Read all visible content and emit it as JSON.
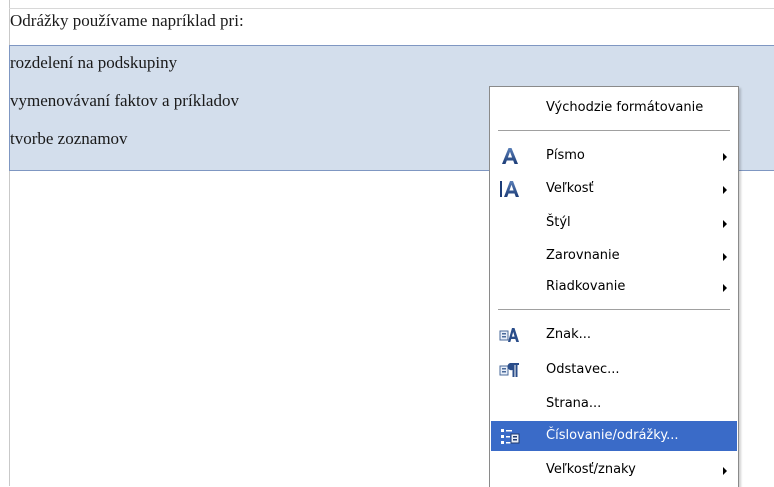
{
  "document": {
    "paragraphs": [
      "Odrážky používame napríklad pri:",
      "rozdelení na podskupiny",
      "vymenovávaní faktov a príkladov",
      "tvorbe zoznamov"
    ]
  },
  "context_menu": {
    "items": [
      {
        "label": "Východzie formátovanie",
        "icon": "",
        "submenu": false,
        "highlighted": false
      },
      {
        "label": "Písmo",
        "icon": "font-icon",
        "submenu": true,
        "highlighted": false
      },
      {
        "label": "Veľkosť",
        "icon": "font-size-icon",
        "submenu": true,
        "highlighted": false
      },
      {
        "label": "Štýl",
        "icon": "",
        "submenu": true,
        "highlighted": false
      },
      {
        "label": "Zarovnanie",
        "icon": "",
        "submenu": true,
        "highlighted": false
      },
      {
        "label": "Riadkovanie",
        "icon": "",
        "submenu": true,
        "highlighted": false
      },
      {
        "label": "Znak...",
        "icon": "character-dialog-icon",
        "submenu": false,
        "highlighted": false
      },
      {
        "label": "Odstavec...",
        "icon": "paragraph-dialog-icon",
        "submenu": false,
        "highlighted": false
      },
      {
        "label": "Strana...",
        "icon": "",
        "submenu": false,
        "highlighted": false
      },
      {
        "label": "Číslovanie/odrážky...",
        "icon": "numbering-bullets-icon",
        "submenu": false,
        "highlighted": true
      },
      {
        "label": "Veľkosť/znaky",
        "icon": "",
        "submenu": true,
        "highlighted": false
      }
    ]
  },
  "colors": {
    "selection": "#d3deec",
    "highlight": "#3a6bc8"
  }
}
